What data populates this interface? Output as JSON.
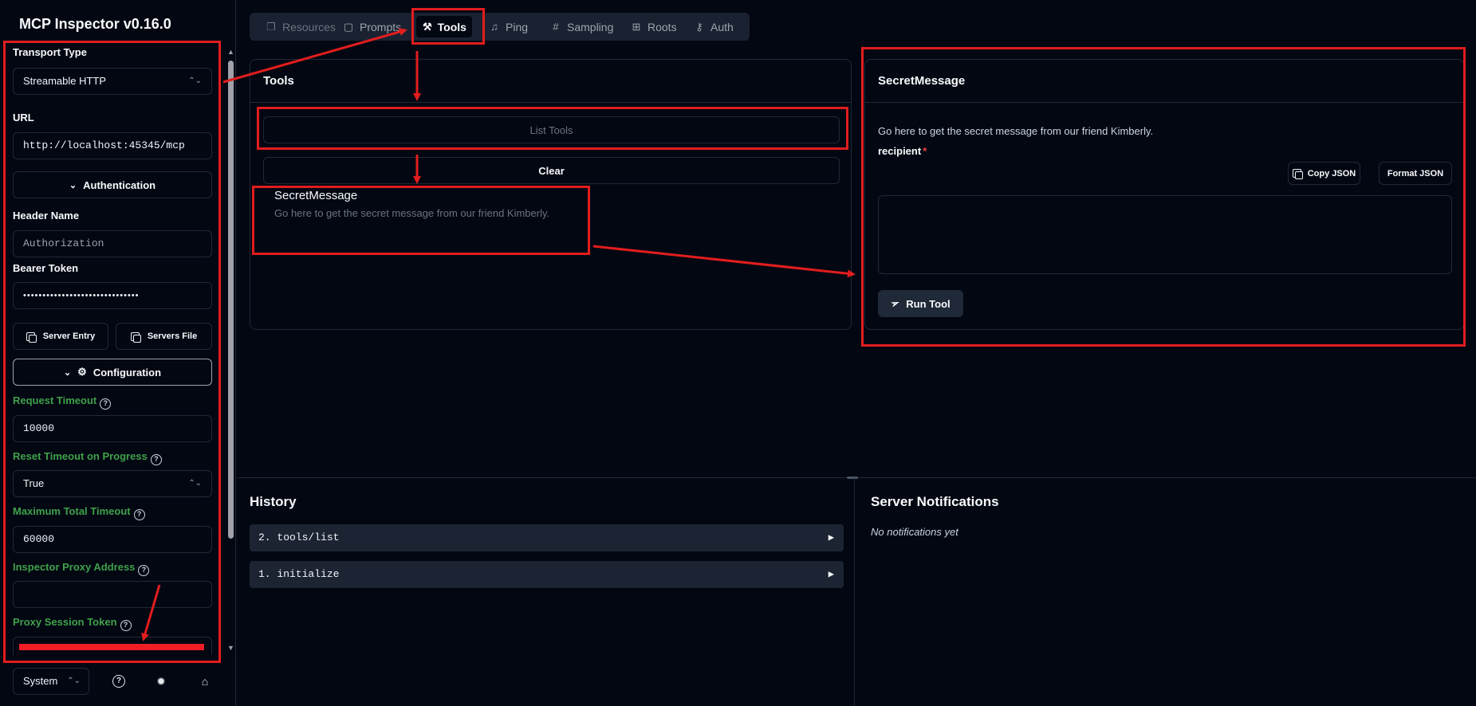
{
  "app": {
    "title": "MCP Inspector v0.16.0"
  },
  "sidebar": {
    "transport_label": "Transport Type",
    "transport_value": "Streamable HTTP",
    "url_label": "URL",
    "url_value": "http://localhost:45345/mcp",
    "auth_button": "Authentication",
    "header_name_label": "Header Name",
    "header_name_placeholder": "Authorization",
    "bearer_label": "Bearer Token",
    "bearer_value": "••••••••••••••••••••••••••••••",
    "server_entry_button": "Server Entry",
    "servers_file_button": "Servers File",
    "config_button": "Configuration",
    "request_timeout_label": "Request Timeout",
    "request_timeout_value": "10000",
    "reset_timeout_label": "Reset Timeout on Progress",
    "reset_timeout_value": "True",
    "max_timeout_label": "Maximum Total Timeout",
    "max_timeout_value": "60000",
    "proxy_address_label": "Inspector Proxy Address",
    "proxy_address_value": "",
    "proxy_token_label": "Proxy Session Token",
    "theme_value": "System"
  },
  "tabs": [
    {
      "label": "Resources",
      "icon": "files-icon"
    },
    {
      "label": "Prompts",
      "icon": "message-square-icon"
    },
    {
      "label": "Tools",
      "icon": "hammer-icon"
    },
    {
      "label": "Ping",
      "icon": "bell-icon"
    },
    {
      "label": "Sampling",
      "icon": "hash-icon"
    },
    {
      "label": "Roots",
      "icon": "folder-tree-icon"
    },
    {
      "label": "Auth",
      "icon": "key-icon"
    }
  ],
  "tools_panel": {
    "title": "Tools",
    "list_button": "List Tools",
    "clear_button": "Clear",
    "tool_name": "SecretMessage",
    "tool_desc": "Go here to get the secret message from our friend Kimberly."
  },
  "tool_detail": {
    "title": "SecretMessage",
    "description": "Go here to get the secret message from our friend Kimberly.",
    "param_label": "recipient",
    "required_mark": "*",
    "copy_json": "Copy JSON",
    "format_json": "Format JSON",
    "run_button": "Run Tool"
  },
  "history": {
    "title": "History",
    "items": [
      "2. tools/list",
      "1. initialize"
    ]
  },
  "notifications": {
    "title": "Server Notifications",
    "empty": "No notifications yet"
  },
  "colors": {
    "background": "#030712",
    "accent_green": "#3fa14a",
    "annotation_red": "#e11d1d"
  }
}
